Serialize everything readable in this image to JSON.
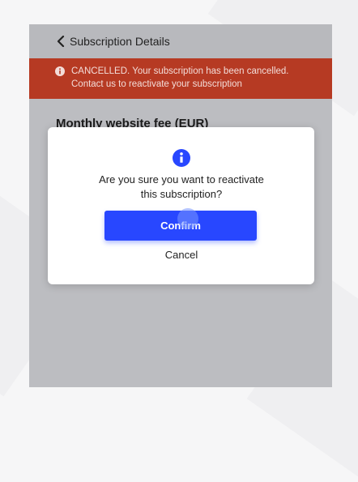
{
  "header": {
    "back_icon": "chevron-left-icon",
    "title": "Subscription Details"
  },
  "alert": {
    "icon": "info-circle-icon",
    "line1": "CANCELLED. Your subscription has been cancelled.",
    "line2": "Contact us to reactivate your subscription",
    "color": "#b63a23"
  },
  "content": {
    "section_title": "Monthly website fee (EUR)"
  },
  "modal": {
    "icon": "info-circle-icon",
    "message_line1": "Are you sure you want to reactivate",
    "message_line2": "this subscription?",
    "confirm_label": "Confirm",
    "cancel_label": "Cancel",
    "accent": "#2847ff"
  }
}
